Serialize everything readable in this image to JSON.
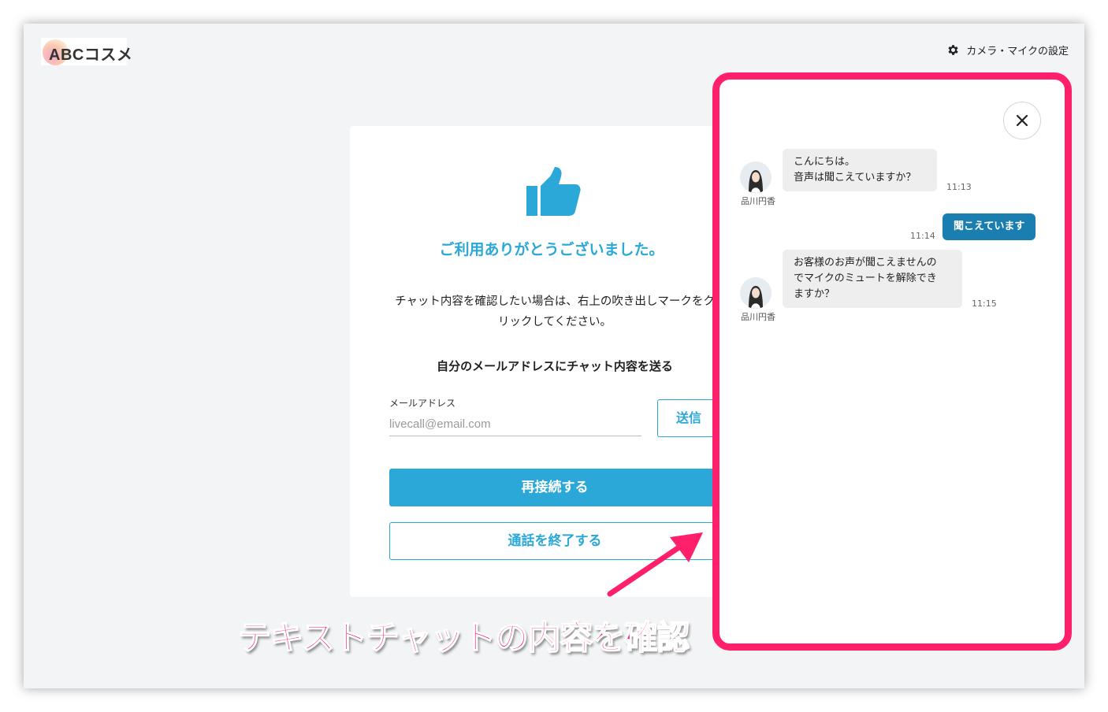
{
  "header": {
    "logo_text": "ABCコスメ",
    "settings_label": "カメラ・マイクの設定",
    "settings_icon": "gear-icon"
  },
  "end_screen": {
    "icon": "thumbs-up-icon",
    "thanks": "ご利用ありがとうございました。",
    "description": "チャット内容を確認したい場合は、右上の吹き出しマークをクリックしてください。",
    "mail_section_title": "自分のメールアドレスにチャット内容を送る",
    "email_label": "メールアドレス",
    "email_placeholder": "livecall@email.com",
    "send_button": "送信",
    "reconnect_button": "再接続する",
    "end_call_button": "通話を終了する"
  },
  "chat": {
    "close_icon": "close-icon",
    "messages": [
      {
        "sender": "品川円香",
        "text_lines": [
          "こんにちは。",
          "音声は聞こえていますか？"
        ],
        "time": "11:13",
        "mine": false
      },
      {
        "sender": "",
        "text_lines": [
          "聞こえています"
        ],
        "time": "11:14",
        "mine": true
      },
      {
        "sender": "品川円香",
        "text_lines": [
          "お客様のお声が聞こえませんの",
          "でマイクのミュートを解除でき",
          "ますか？"
        ],
        "time": "11:15",
        "mine": false
      }
    ]
  },
  "annotation": {
    "caption": "テキストチャットの内容を確認",
    "color": "#ff1f6a"
  },
  "colors": {
    "accent": "#2ba8d8",
    "my_bubble": "#1a7fb0",
    "highlight": "#ff1f6a"
  }
}
